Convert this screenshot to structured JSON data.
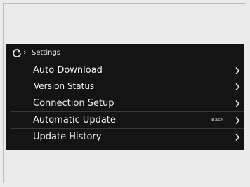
{
  "header": {
    "back_icon": "refresh-back-icon",
    "title": "Settings"
  },
  "menu": {
    "items": [
      {
        "label": "Auto Download",
        "value": "",
        "chevron_icon": "chevron-right-icon"
      },
      {
        "label": "Version Status",
        "value": "",
        "chevron_icon": "chevron-right-icon"
      },
      {
        "label": "Connection Setup",
        "value": "",
        "chevron_icon": "chevron-right-icon"
      },
      {
        "label": "Automatic Update",
        "value": "Back",
        "chevron_icon": "chevron-right-icon"
      },
      {
        "label": "Update History",
        "value": "",
        "chevron_icon": "chevron-right-icon"
      }
    ]
  },
  "colors": {
    "screen_background": "#141414",
    "page_background": "#ebebeb",
    "text": "#f0f0f0",
    "divider": "#3a3a3a"
  }
}
